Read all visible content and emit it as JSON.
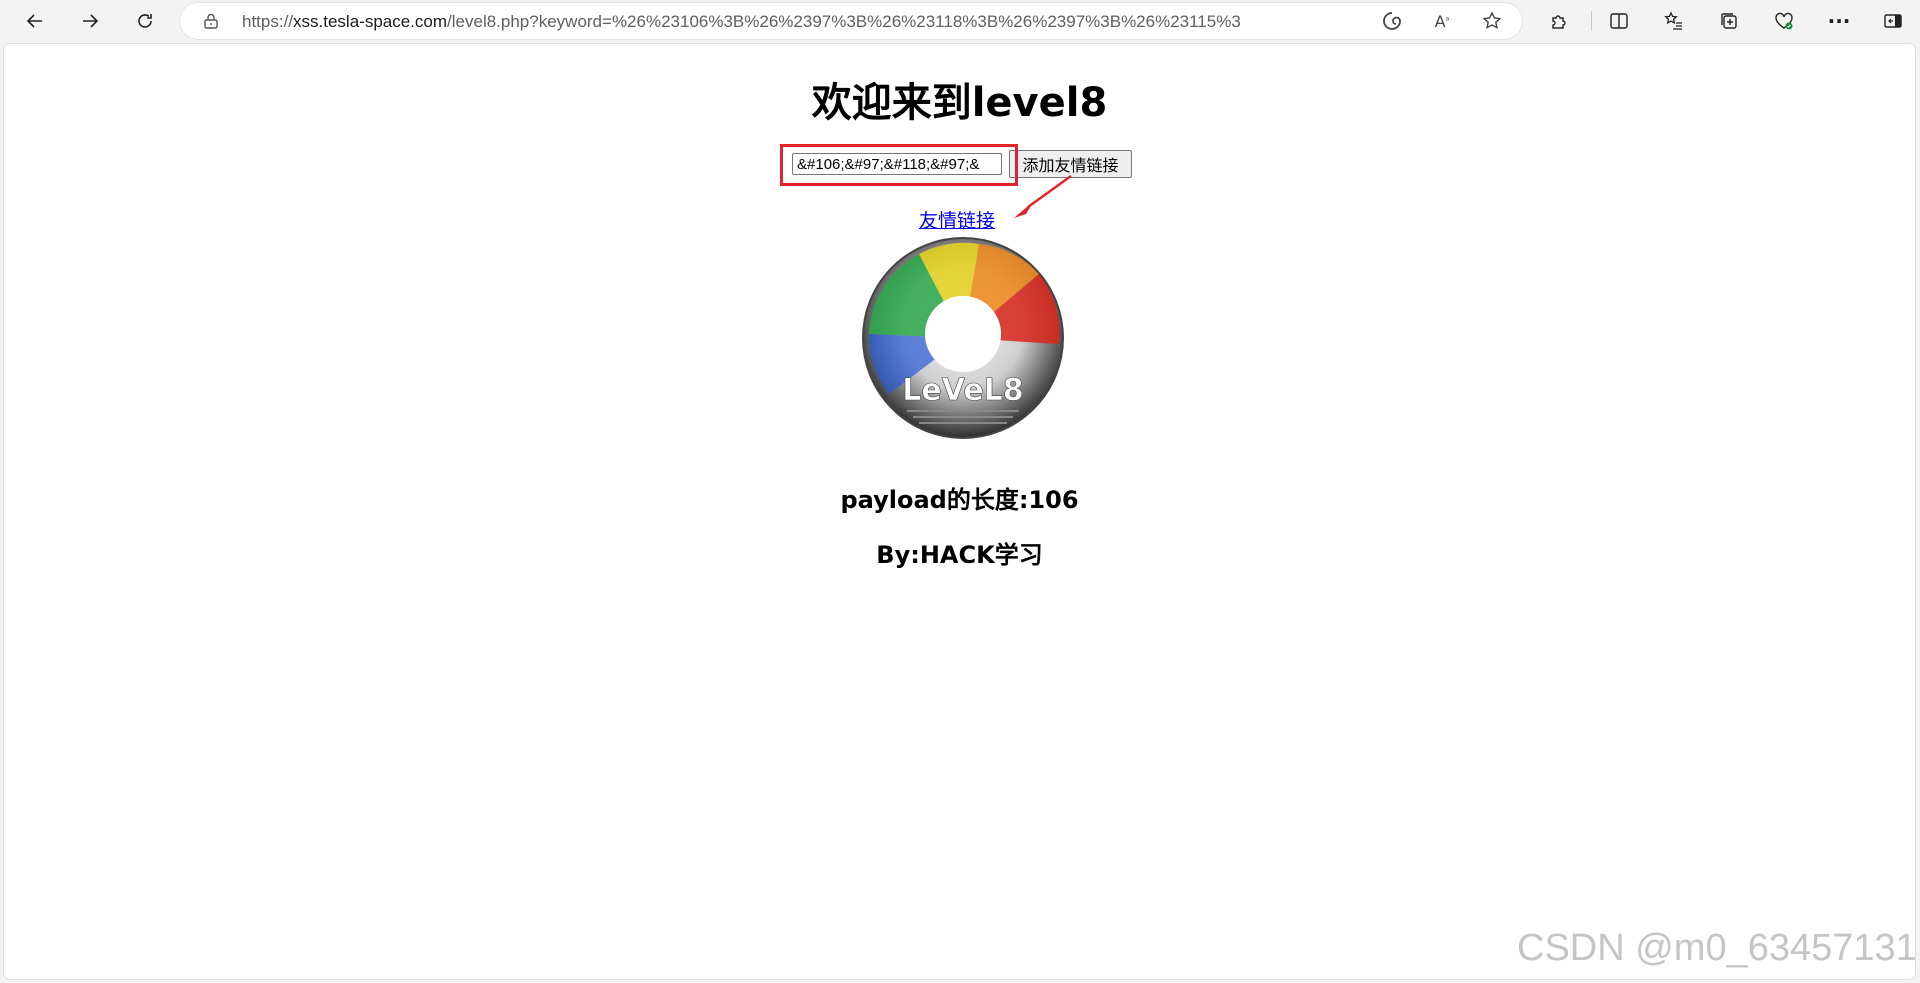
{
  "browser": {
    "url_prefix": "https://",
    "url_host": "xss.tesla-space.com",
    "url_rest": "/level8.php?keyword=%26%23106%3B%26%2397%3B%26%23118%3B%26%2397%3B%26%23115%3B%26%2399%..."
  },
  "page": {
    "title": "欢迎来到level8",
    "keyword_input_value": "&#106;&#97;&#118;&#97;&",
    "submit_label": "添加友情链接",
    "friend_link_text": "友情链接",
    "disc_logo_text": "LeVeL8",
    "payload_length": "payload的长度:106",
    "author": "By:HACK学习"
  },
  "watermark": "CSDN @m0_63457131",
  "colors": {
    "highlight_box": "#e0242a",
    "link": "#0000ee"
  }
}
